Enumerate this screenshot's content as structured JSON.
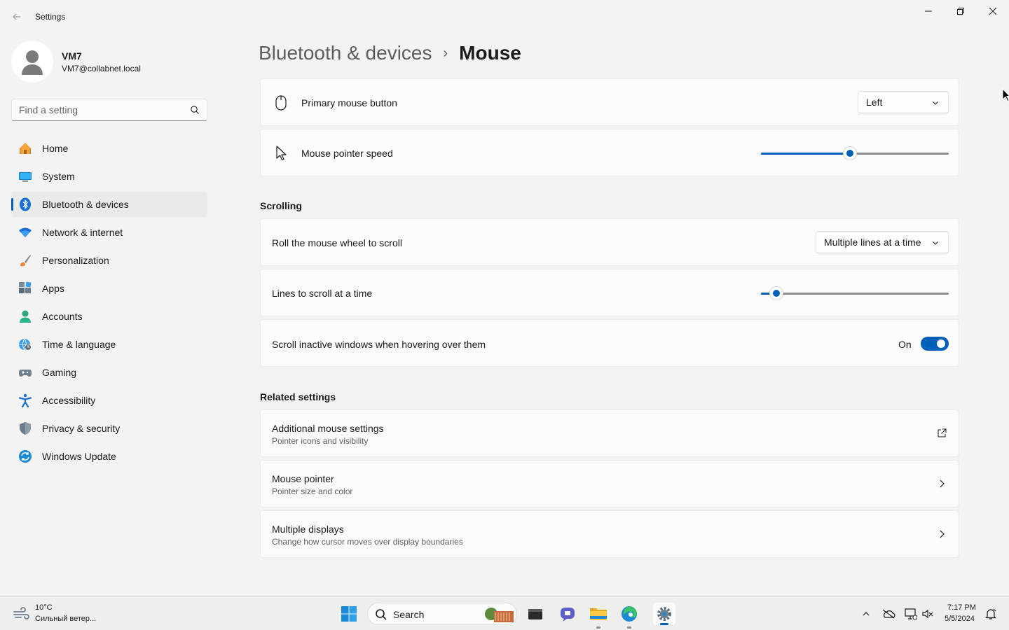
{
  "window": {
    "title": "Settings",
    "back_icon": "back-arrow-icon",
    "controls": [
      "minimize-icon",
      "maximize-icon",
      "close-icon"
    ]
  },
  "profile": {
    "name": "VM7",
    "email": "VM7@collabnet.local"
  },
  "search": {
    "placeholder": "Find a setting",
    "value": ""
  },
  "sidebar": {
    "items": [
      {
        "label": "Home",
        "icon": "home-icon",
        "active": false
      },
      {
        "label": "System",
        "icon": "system-icon",
        "active": false
      },
      {
        "label": "Bluetooth & devices",
        "icon": "bluetooth-icon",
        "active": true
      },
      {
        "label": "Network & internet",
        "icon": "wifi-icon",
        "active": false
      },
      {
        "label": "Personalization",
        "icon": "brush-icon",
        "active": false
      },
      {
        "label": "Apps",
        "icon": "apps-icon",
        "active": false
      },
      {
        "label": "Accounts",
        "icon": "accounts-icon",
        "active": false
      },
      {
        "label": "Time & language",
        "icon": "globe-clock-icon",
        "active": false
      },
      {
        "label": "Gaming",
        "icon": "gamepad-icon",
        "active": false
      },
      {
        "label": "Accessibility",
        "icon": "accessibility-icon",
        "active": false
      },
      {
        "label": "Privacy & security",
        "icon": "shield-icon",
        "active": false
      },
      {
        "label": "Windows Update",
        "icon": "update-icon",
        "active": false
      }
    ]
  },
  "breadcrumb": {
    "parent": "Bluetooth & devices",
    "separator": "›",
    "current": "Mouse"
  },
  "settings": {
    "primary_button": {
      "label": "Primary mouse button",
      "value": "Left"
    },
    "pointer_speed": {
      "label": "Mouse pointer speed",
      "value_fraction": 0.47
    }
  },
  "scrolling": {
    "title": "Scrolling",
    "roll_wheel": {
      "label": "Roll the mouse wheel to scroll",
      "value": "Multiple lines at a time"
    },
    "lines": {
      "label": "Lines to scroll at a time",
      "value_fraction": 0.05
    },
    "inactive": {
      "label": "Scroll inactive windows when hovering over them",
      "state": "On",
      "enabled": true
    }
  },
  "related": {
    "title": "Related settings",
    "items": [
      {
        "label": "Additional mouse settings",
        "sub": "Pointer icons and visibility",
        "action": "external-link-icon"
      },
      {
        "label": "Mouse pointer",
        "sub": "Pointer size and color",
        "action": "chevron-right-icon"
      },
      {
        "label": "Multiple displays",
        "sub": "Change how cursor moves over display boundaries",
        "action": "chevron-right-icon"
      }
    ]
  },
  "taskbar": {
    "weather": {
      "temp": "10°C",
      "desc": "Сильный ветер..."
    },
    "search_label": "Search",
    "clock": {
      "time": "7:17 PM",
      "date": "5/5/2024"
    }
  },
  "colors": {
    "accent": "#005fb8",
    "background": "#f3f3f3",
    "card": "#fbfbfb"
  }
}
